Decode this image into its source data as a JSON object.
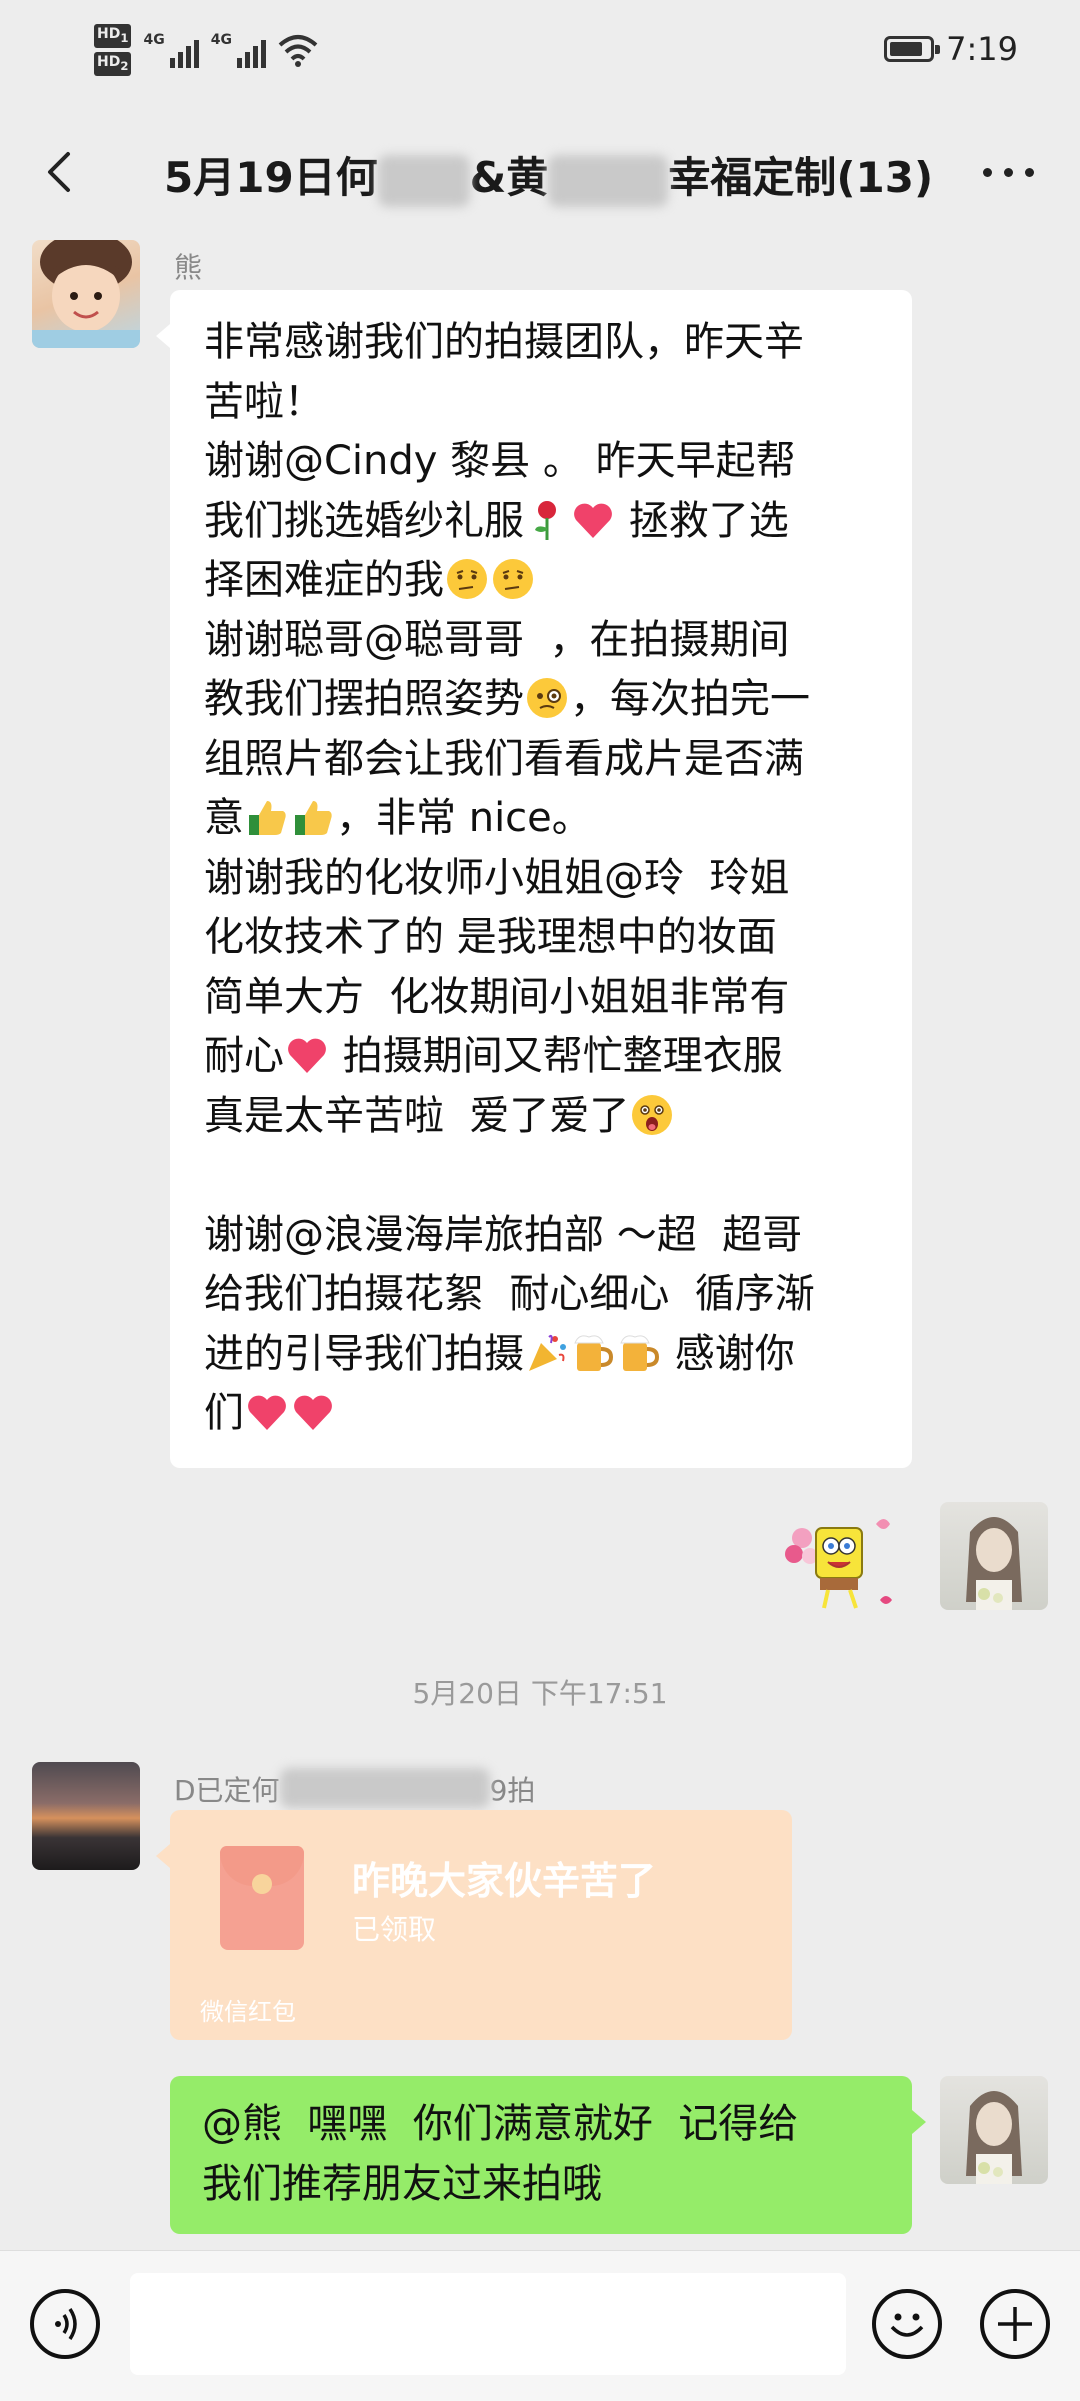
{
  "status_bar": {
    "hd1": "HD",
    "hd1_sub": "1",
    "hd2": "HD",
    "hd2_sub": "2",
    "sig1": "4G",
    "sig2": "4G",
    "battery_level": 0.85,
    "time": "7:19"
  },
  "header": {
    "title_part1": "5月19日何",
    "title_part2": "&黄",
    "title_part3": "幸福定制(13)"
  },
  "messages": {
    "m1": {
      "sender": "熊",
      "lines": [
        {
          "text": "非常感谢我们的拍摄团队，昨天辛"
        },
        {
          "text": "苦啦！"
        },
        {
          "text": "谢谢@Cindy 黎县 。 昨天早起帮"
        },
        {
          "text": "我们挑选婚纱礼服",
          "emoji": [
            "rose-emoji",
            "heart-emoji"
          ],
          "after": " 拯救了选"
        },
        {
          "text": "择困难症的我",
          "emoji": [
            "thinking-face-emoji",
            "thinking-face-emoji"
          ]
        },
        {
          "text": "谢谢聪哥@聪哥哥  ，在拍摄期间"
        },
        {
          "text": "教我们摆拍照姿势",
          "emoji": [
            "monocle-face-emoji"
          ],
          "after": "，每次拍完一"
        },
        {
          "text": "组照片都会让我们看看成片是否满"
        },
        {
          "text": "意",
          "emoji": [
            "thumbs-up-emoji",
            "thumbs-up-emoji"
          ],
          "after": "，非常 nice。"
        },
        {
          "text": "谢谢我的化妆师小姐姐@玲  玲姐"
        },
        {
          "text": "化妆技术了的 是我理想中的妆面"
        },
        {
          "text": "简单大方  化妆期间小姐姐非常有"
        },
        {
          "text": "耐心",
          "emoji": [
            "heart-emoji"
          ],
          "after": " 拍摄期间又帮忙整理衣服"
        },
        {
          "text": "真是太辛苦啦  爱了爱了",
          "emoji": [
            "astonished-face-emoji"
          ]
        },
        {
          "text": ""
        },
        {
          "text": "谢谢@浪漫海岸旅拍部 ～超  超哥"
        },
        {
          "text": "给我们拍摄花絮  耐心细心  循序渐"
        },
        {
          "text": "进的引导我们拍摄",
          "emoji": [
            "party-popper-emoji",
            "beer-mug-emoji",
            "beer-mug-emoji"
          ],
          "after": " 感谢你"
        },
        {
          "text": "们",
          "emoji": [
            "heart-emoji",
            "heart-emoji"
          ]
        }
      ]
    },
    "m2_sticker": "spongebob-flowers-sticker",
    "timestamp": "5月20日 下午17:51",
    "m3": {
      "sender_part1": "D已定何",
      "sender_part2": "9拍",
      "red_packet": {
        "title": "昨晚大家伙辛苦了",
        "status": "已领取",
        "brand": "微信红包"
      }
    },
    "m4": {
      "lines": [
        {
          "text": "@熊  嘿嘿  你们满意就好  记得给"
        },
        {
          "text": "我们推荐朋友过来拍哦"
        }
      ]
    }
  },
  "input_bar": {
    "placeholder": ""
  }
}
